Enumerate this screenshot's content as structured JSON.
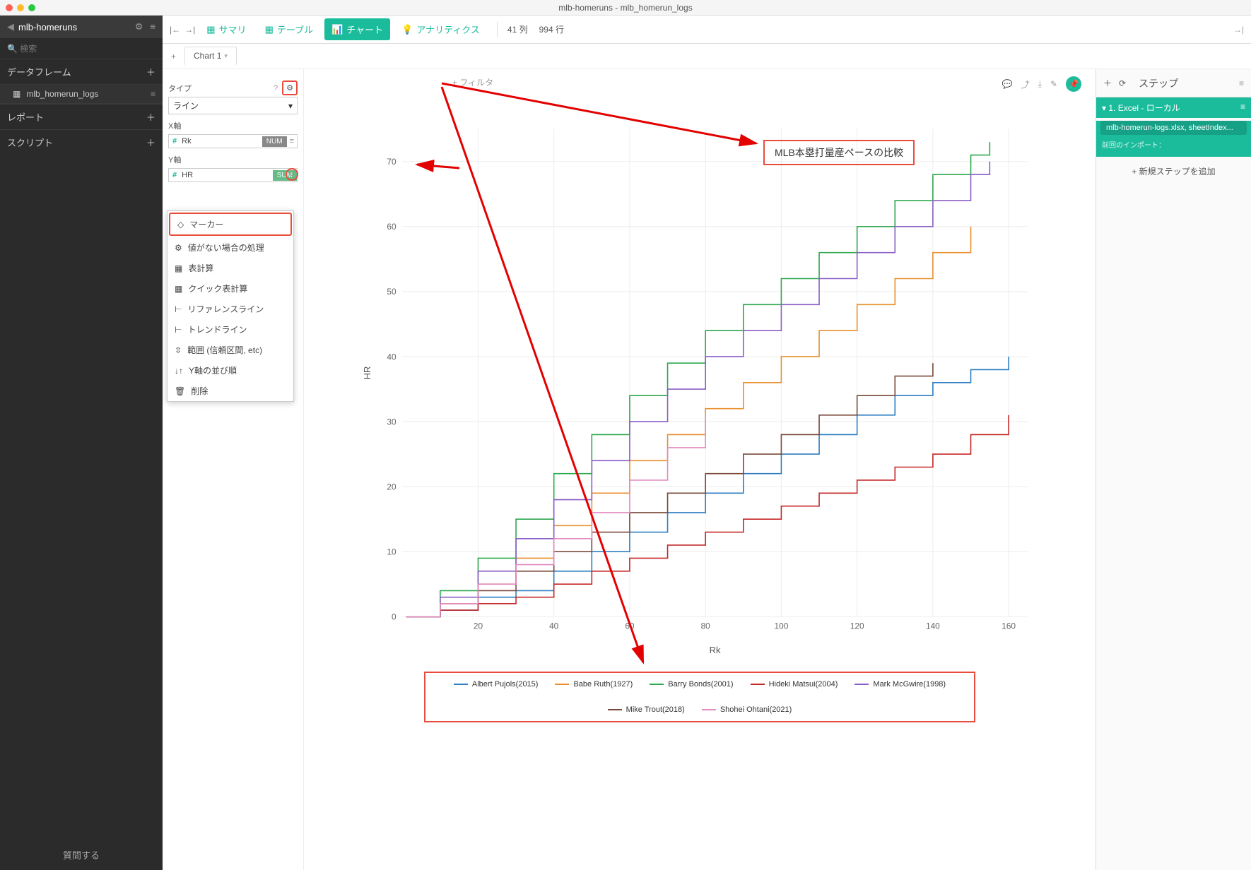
{
  "window_title": "mlb-homeruns - mlb_homerun_logs",
  "sidebar": {
    "title": "mlb-homeruns",
    "search_placeholder": "検索",
    "sections": {
      "dataframes": "データフレーム",
      "reports": "レポート",
      "scripts": "スクリプト"
    },
    "items": [
      "mlb_homerun_logs"
    ],
    "footer": "質問する"
  },
  "toolbar": {
    "summary": "サマリ",
    "table": "テーブル",
    "chart": "チャート",
    "analytics": "アナリティクス",
    "cols": "41 列",
    "rows": "994 行"
  },
  "tabs": {
    "add": "+",
    "chart1": "Chart 1"
  },
  "config": {
    "type_label": "タイプ",
    "type_value": "ライン",
    "xaxis_label": "X軸",
    "xaxis_field": "Rk",
    "xaxis_agg": "NUM",
    "yaxis_label": "Y軸",
    "yaxis_field": "HR",
    "yaxis_agg": "SUM"
  },
  "dropdown": {
    "items": [
      "マーカー",
      "値がない場合の処理",
      "表計算",
      "クイック表計算",
      "リファレンスライン",
      "トレンドライン",
      "範囲 (信頼区間, etc)",
      "Y軸の並び順",
      "削除"
    ]
  },
  "filter_label": "+ フィルタ",
  "chart_title": "MLB本塁打量産ペースの比較",
  "steps": {
    "header": "ステップ",
    "step1_title": "1. Excel - ローカル",
    "step1_file": "mlb-homerun-logs.xlsx, sheetIndex...",
    "step1_meta": "前回のインポート：",
    "add": "+  新規ステップを追加"
  },
  "chart_data": {
    "type": "line",
    "title": "MLB本塁打量産ペースの比較",
    "xlabel": "Rk",
    "ylabel": "HR",
    "xlim": [
      0,
      165
    ],
    "ylim": [
      0,
      75
    ],
    "xticks": [
      20,
      40,
      60,
      80,
      100,
      120,
      140,
      160
    ],
    "yticks": [
      0,
      10,
      20,
      30,
      40,
      50,
      60,
      70
    ],
    "series": [
      {
        "name": "Albert Pujols(2015)",
        "color": "#2e7ec2",
        "x": [
          1,
          10,
          20,
          30,
          40,
          50,
          60,
          70,
          80,
          90,
          100,
          110,
          120,
          130,
          140,
          150,
          160
        ],
        "y": [
          0,
          1,
          3,
          4,
          7,
          10,
          13,
          16,
          19,
          22,
          25,
          28,
          31,
          34,
          36,
          38,
          40
        ]
      },
      {
        "name": "Babe Ruth(1927)",
        "color": "#e8902e",
        "x": [
          1,
          10,
          20,
          30,
          40,
          50,
          60,
          70,
          80,
          90,
          100,
          110,
          120,
          130,
          140,
          150
        ],
        "y": [
          0,
          2,
          5,
          9,
          14,
          19,
          24,
          28,
          32,
          36,
          40,
          44,
          48,
          52,
          56,
          60
        ]
      },
      {
        "name": "Barry Bonds(2001)",
        "color": "#2fa84f",
        "x": [
          1,
          10,
          20,
          30,
          40,
          50,
          60,
          70,
          80,
          90,
          100,
          110,
          120,
          130,
          140,
          150,
          155
        ],
        "y": [
          0,
          4,
          9,
          15,
          22,
          28,
          34,
          39,
          44,
          48,
          52,
          56,
          60,
          64,
          68,
          71,
          73
        ]
      },
      {
        "name": "Hideki Matsui(2004)",
        "color": "#c62828",
        "x": [
          1,
          10,
          20,
          30,
          40,
          50,
          60,
          70,
          80,
          90,
          100,
          110,
          120,
          130,
          140,
          150,
          160
        ],
        "y": [
          0,
          1,
          2,
          3,
          5,
          7,
          9,
          11,
          13,
          15,
          17,
          19,
          21,
          23,
          25,
          28,
          31
        ]
      },
      {
        "name": "Mark McGwire(1998)",
        "color": "#8a5fc7",
        "x": [
          1,
          10,
          20,
          30,
          40,
          50,
          60,
          70,
          80,
          90,
          100,
          110,
          120,
          130,
          140,
          150,
          155
        ],
        "y": [
          0,
          3,
          7,
          12,
          18,
          24,
          30,
          35,
          40,
          44,
          48,
          52,
          56,
          60,
          64,
          68,
          70
        ]
      },
      {
        "name": "Mike Trout(2018)",
        "color": "#7a4a3a",
        "x": [
          1,
          10,
          20,
          30,
          40,
          50,
          60,
          70,
          80,
          90,
          100,
          110,
          120,
          130,
          140
        ],
        "y": [
          0,
          2,
          4,
          7,
          10,
          13,
          16,
          19,
          22,
          25,
          28,
          31,
          34,
          37,
          39
        ]
      },
      {
        "name": "Shohei Ohtani(2021)",
        "color": "#e38bc0",
        "x": [
          1,
          10,
          20,
          30,
          40,
          50,
          60,
          70,
          80
        ],
        "y": [
          0,
          2,
          5,
          8,
          12,
          16,
          21,
          26,
          31
        ]
      }
    ]
  }
}
